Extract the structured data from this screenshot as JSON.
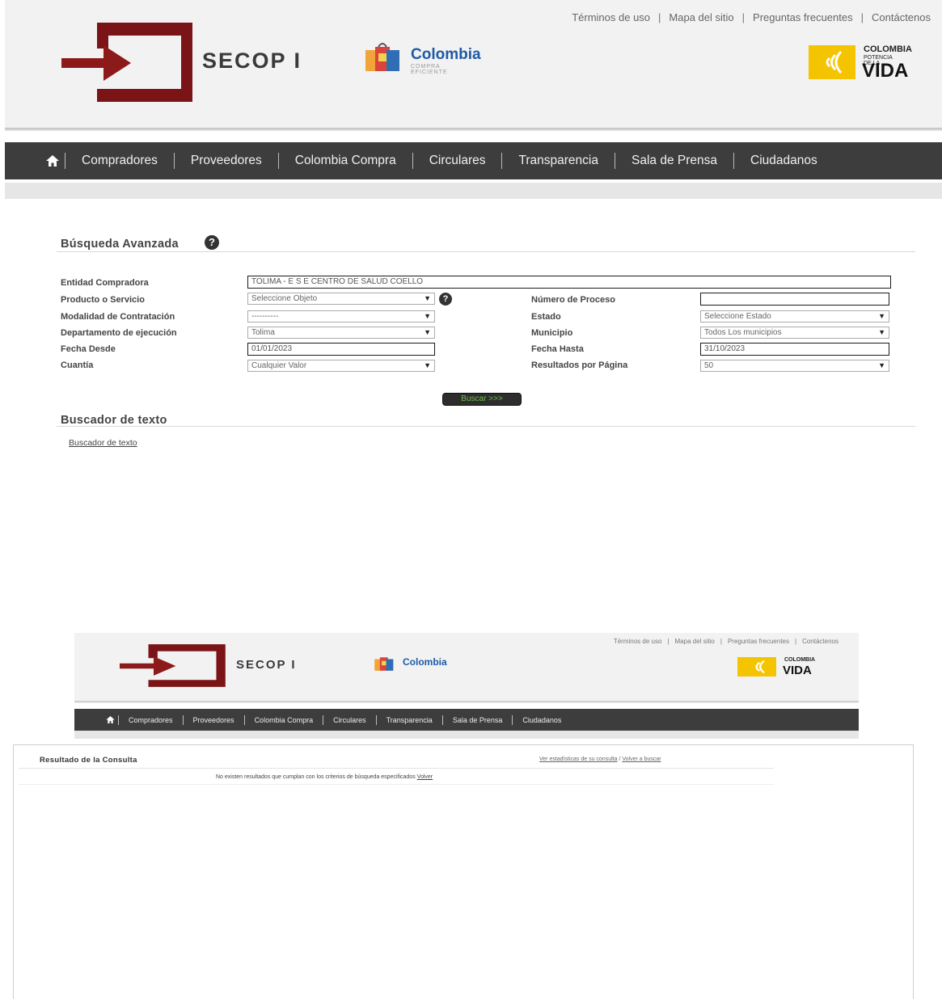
{
  "header": {
    "top_links": [
      "Términos de uso",
      "Mapa del sitio",
      "Preguntas frecuentes",
      "Contáctenos"
    ],
    "site_name": "SECOP I",
    "cc_logo": {
      "word": "Colombia",
      "sub": "COMPRA EFICIENTE"
    },
    "gov_logo": {
      "line1": "COLOMBIA",
      "line2": "POTENCIA DE LA",
      "big": "VIDA"
    },
    "colors": {
      "logo_red": "#7a1416",
      "nav_bg": "#3d3d3d",
      "vida_yellow": "#f5c400"
    }
  },
  "nav": {
    "home_icon": "home-icon",
    "items": [
      "Compradores",
      "Proveedores",
      "Colombia Compra",
      "Circulares",
      "Transparencia",
      "Sala de Prensa",
      "Ciudadanos"
    ]
  },
  "search": {
    "title": "Búsqueda Avanzada",
    "help_icon": "help-icon",
    "fields": {
      "entidad_label": "Entidad Compradora",
      "entidad_value": "TOLIMA - E S E  CENTRO DE SALUD COELLO",
      "producto_label": "Producto o Servicio",
      "producto_value": "Seleccione Objeto",
      "numero_label": "Número de Proceso",
      "numero_value": "",
      "modalidad_label": "Modalidad de Contratación",
      "modalidad_value": "----------",
      "estado_label": "Estado",
      "estado_value": "Seleccione Estado",
      "departamento_label": "Departamento de ejecución",
      "departamento_value": "Tolima",
      "municipio_label": "Municipio",
      "municipio_value": "Todos Los municipios",
      "fecha_desde_label": "Fecha Desde",
      "fecha_desde_value": "01/01/2023",
      "fecha_hasta_label": "Fecha Hasta",
      "fecha_hasta_value": "31/10/2023",
      "cuantia_label": "Cuantía",
      "cuantia_value": "Cualquier Valor",
      "resultados_label": "Resultados por Página",
      "resultados_value": "50"
    },
    "button_label": "Buscar >>>"
  },
  "text_search": {
    "title": "Buscador de texto",
    "link": "Buscador de texto"
  },
  "results": {
    "title": "Resultado de la Consulta",
    "link_stats": "Ver estadísticas de su consulta",
    "link_back": "Volver a buscar",
    "message": "No existen resultados que cumplan con los criterios de búsqueda especificados",
    "message_link": "Volver"
  }
}
